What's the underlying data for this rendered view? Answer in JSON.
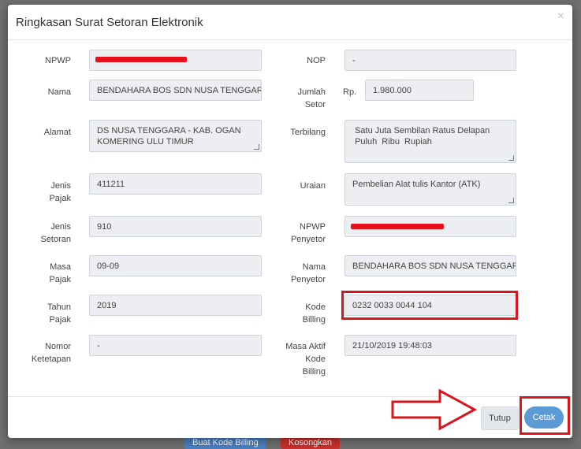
{
  "modal": {
    "title": "Ringkasan Surat Setoran Elektronik",
    "close_icon": "×"
  },
  "left": {
    "npwp_label": "NPWP",
    "nama_label": "Nama",
    "nama_value": "BENDAHARA BOS SDN NUSA TENGGARA",
    "alamat_label": "Alamat",
    "alamat_value": "DS NUSA TENGGARA - KAB. OGAN\nKOMERING ULU TIMUR",
    "jenis_pajak_label": "Jenis\nPajak",
    "jenis_pajak_value": "411211",
    "jenis_setoran_label": "Jenis\nSetoran",
    "jenis_setoran_value": "910",
    "masa_pajak_label": "Masa\nPajak",
    "masa_pajak_value": "09-09",
    "tahun_pajak_label": "Tahun\nPajak",
    "tahun_pajak_value": "2019",
    "nomor_ketetapan_label": "Nomor\nKetetapan",
    "nomor_ketetapan_value": "-"
  },
  "right": {
    "nop_label": "NOP",
    "nop_value": "-",
    "jumlah_setor_label": "Jumlah\nSetor",
    "currency": "Rp.",
    "jumlah_setor_value": "1.980.000",
    "terbilang_label": "Terbilang",
    "terbilang_value": " Satu Juta Sembilan Ratus Delapan\n Puluh  Ribu  Rupiah",
    "uraian_label": "Uraian",
    "uraian_value": "Pembelian Alat tulis Kantor (ATK)",
    "npwp_penyetor_label": "NPWP\nPenyetor",
    "nama_penyetor_label": "Nama\nPenyetor",
    "nama_penyetor_value": "BENDAHARA BOS SDN NUSA TENGGARA",
    "kode_billing_label": "Kode\nBilling",
    "kode_billing_value": "0232 0033 0044 104",
    "masa_aktif_label": "Masa Aktif\nKode\nBilling",
    "masa_aktif_value": "21/10/2019 19:48:03"
  },
  "footer": {
    "tutup_label": "Tutup",
    "cetak_label": "Cetak"
  },
  "background": {
    "buat_kode_billing": "Buat Kode Billing",
    "kosongkan": "Kosongkan"
  },
  "colors": {
    "primary": "#5b9bd5",
    "highlight_red": "#d9151e",
    "field_bg": "#eceef1"
  }
}
